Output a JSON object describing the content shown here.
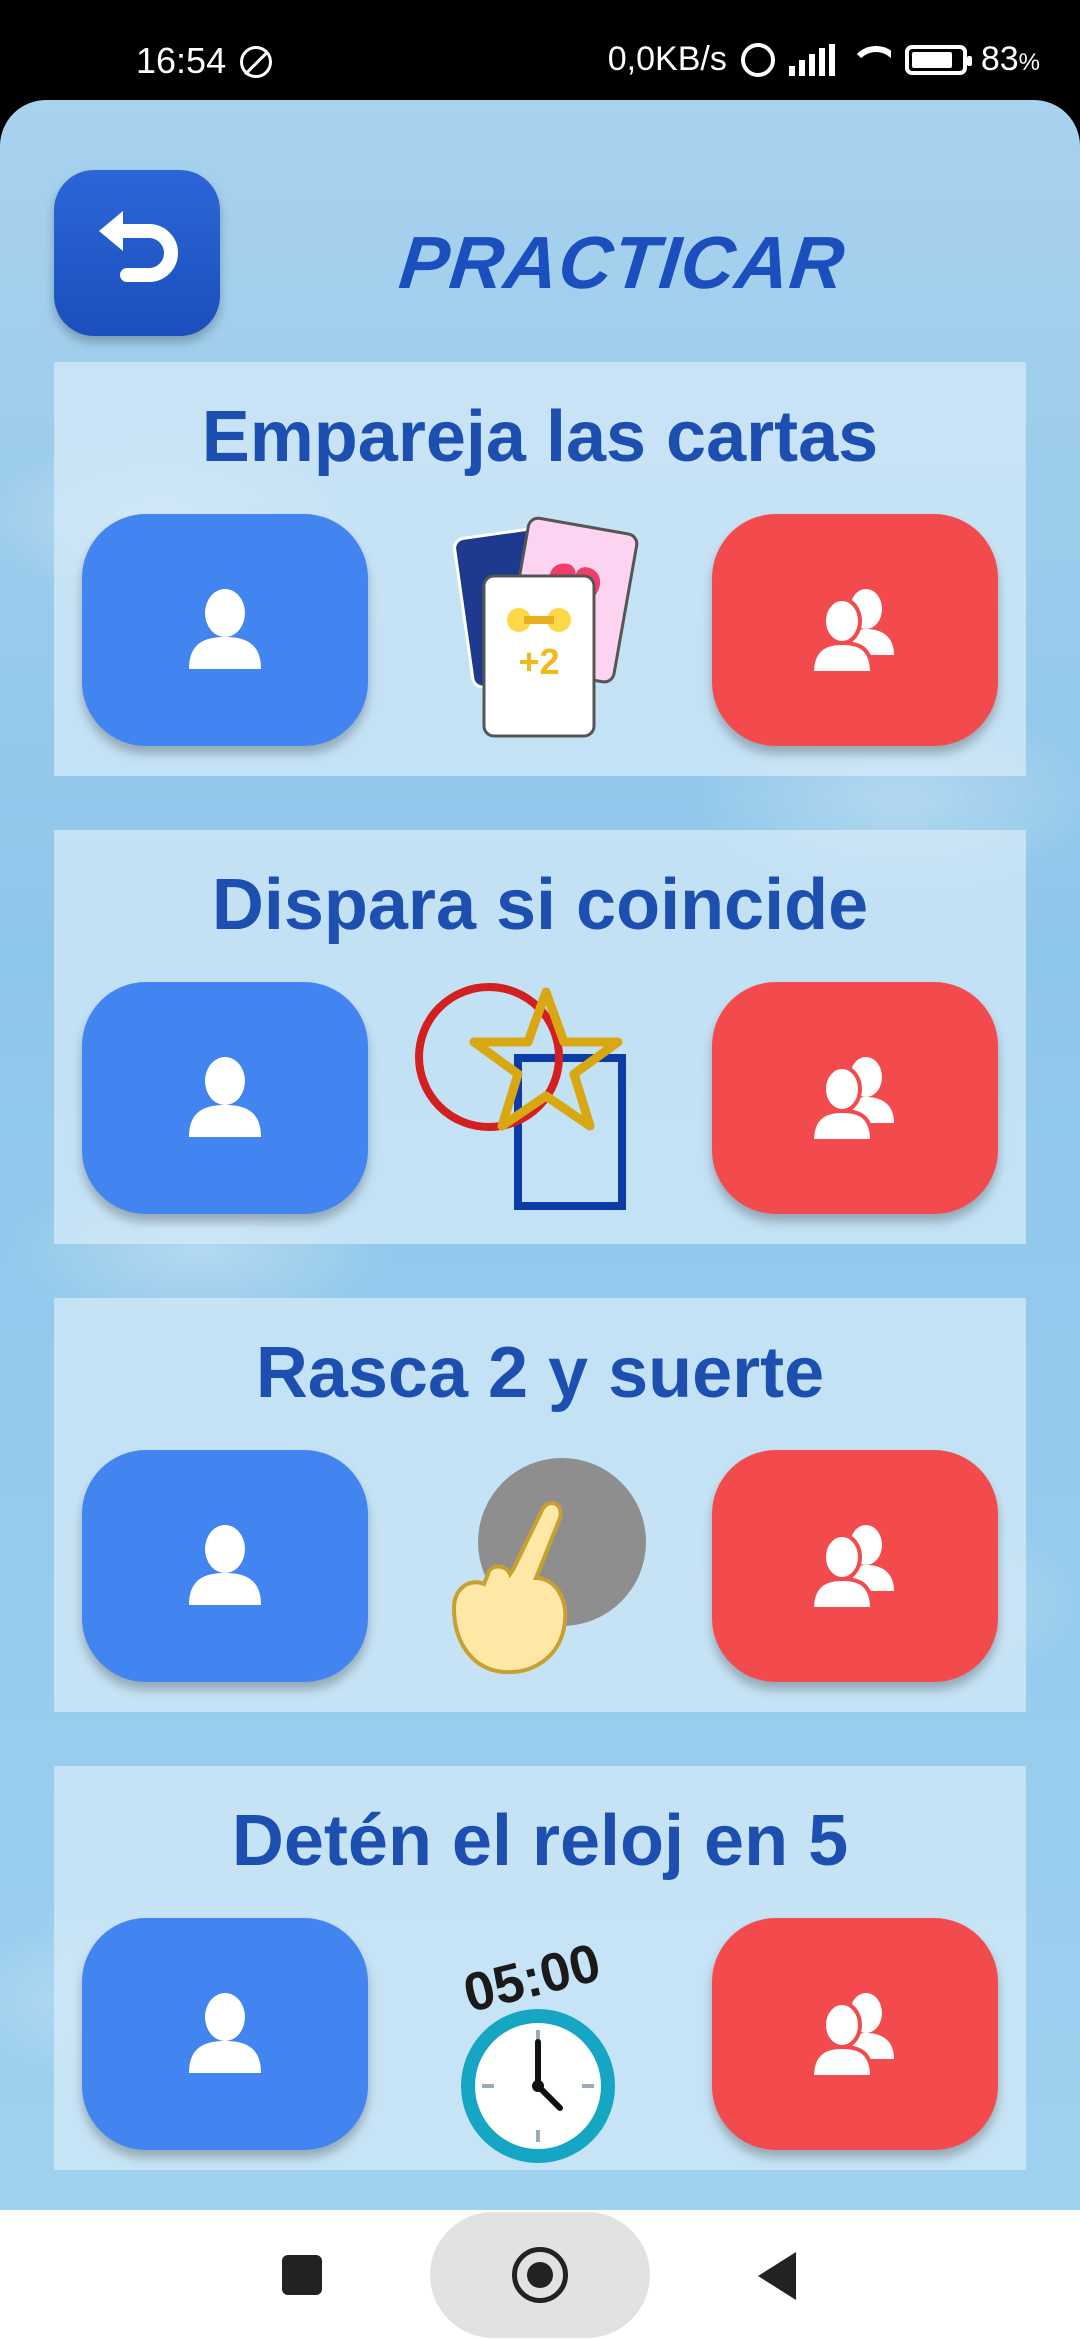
{
  "status_bar": {
    "time": "16:54",
    "network_speed": "0,0KB/s",
    "battery_percent": "83",
    "battery_unit": "%",
    "battery_level": 0.83
  },
  "header": {
    "title": "PRACTICAR",
    "back_icon": "back-arrow-icon"
  },
  "games": [
    {
      "title": "Empareja las cartas",
      "illustration": "cards-icon",
      "card_badge": "+2"
    },
    {
      "title": "Dispara si coincide",
      "illustration": "shapes-icon"
    },
    {
      "title": "Rasca 2 y suerte",
      "illustration": "scratch-icon"
    },
    {
      "title": "Detén el reloj en 5",
      "illustration": "clock-icon",
      "clock_text": "05:00"
    }
  ],
  "buttons": {
    "single_player_icon": "person-icon",
    "multi_player_icon": "group-icon"
  },
  "colors": {
    "accent_blue": "#1c4fb0",
    "single_button": "#4285f0",
    "multi_button": "#f34b4d"
  }
}
